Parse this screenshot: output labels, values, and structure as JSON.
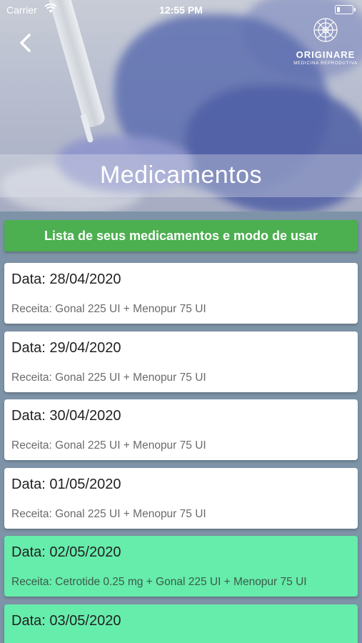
{
  "status": {
    "carrier": "Carrier",
    "time": "12:55 PM"
  },
  "header": {
    "title": "Medicamentos",
    "logo_name": "ORIGINARE",
    "logo_sub": "MEDICINA REPRODUTIVA"
  },
  "banner": {
    "text": "Lista de seus medicamentos e modo de usar"
  },
  "colors": {
    "banner": "#4caf50",
    "highlight_card": "#66ecab",
    "background": "#7e93a7"
  },
  "items": [
    {
      "date": "Data: 28/04/2020",
      "recipe": "Receita: Gonal 225 UI + Menopur 75 UI",
      "highlight": false
    },
    {
      "date": "Data: 29/04/2020",
      "recipe": "Receita: Gonal 225 UI + Menopur 75 UI",
      "highlight": false
    },
    {
      "date": "Data: 30/04/2020",
      "recipe": "Receita: Gonal 225 UI + Menopur 75 UI",
      "highlight": false
    },
    {
      "date": "Data: 01/05/2020",
      "recipe": "Receita: Gonal 225 UI + Menopur 75 UI",
      "highlight": false
    },
    {
      "date": "Data: 02/05/2020",
      "recipe": "Receita: Cetrotide 0.25 mg + Gonal 225 UI + Menopur 75 UI",
      "highlight": true
    },
    {
      "date": "Data: 03/05/2020",
      "recipe": "",
      "highlight": true
    }
  ]
}
